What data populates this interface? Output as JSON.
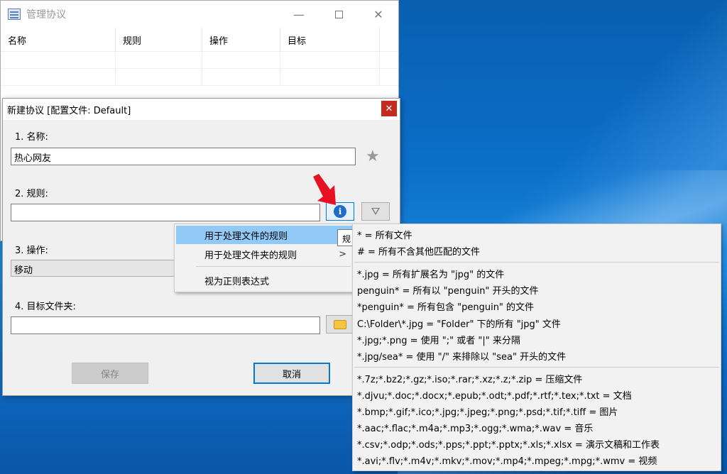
{
  "main": {
    "title": "管理协议",
    "columns": [
      "名称",
      "规则",
      "操作",
      "目标"
    ]
  },
  "dialog": {
    "title": "新建协议 [配置文件: Default]",
    "close": "✕",
    "name_label": "1.  名称:",
    "name_value": "热心网友",
    "rule_label": "2.  规则:",
    "rule_value": "",
    "action_label": "3.  操作:",
    "action_value": "移动",
    "target_label": "4.  目标文件夹:",
    "target_value": "",
    "save_label": "保存",
    "cancel_label": "取消"
  },
  "context_menu": {
    "items": [
      {
        "label": "用于处理文件的规则"
      },
      {
        "label": "用于处理文件夹的规则",
        "chevron": ">"
      },
      {
        "label": "视为正则表达式"
      }
    ]
  },
  "tooltip": {
    "text": "规"
  },
  "help": {
    "group1": [
      "* = 所有文件",
      "# = 所有不含其他匹配的文件"
    ],
    "group2": [
      "*.jpg = 所有扩展名为 \"jpg\" 的文件",
      "penguin* = 所有以 \"penguin\" 开头的文件",
      "*penguin* = 所有包含 \"penguin\" 的文件",
      "C:\\Folder\\*.jpg = \"Folder\" 下的所有 \"jpg\" 文件",
      "*.jpg;*.png = 使用 \";\" 或者 \"|\" 来分隔",
      "*.jpg/sea* = 使用 \"/\" 来排除以 \"sea\" 开头的文件"
    ],
    "group3": [
      "*.7z;*.bz2;*.gz;*.iso;*.rar;*.xz;*.z;*.zip = 压缩文件",
      "*.djvu;*.doc;*.docx;*.epub;*.odt;*.pdf;*.rtf;*.tex;*.txt = 文档",
      "*.bmp;*.gif;*.ico;*.jpg;*.jpeg;*.png;*.psd;*.tif;*.tiff = 图片",
      "*.aac;*.flac;*.m4a;*.mp3;*.ogg;*.wma;*.wav = 音乐",
      "*.csv;*.odp;*.ods;*.pps;*.ppt;*.pptx;*.xls;*.xlsx = 演示文稿和工作表",
      "*.avi;*.flv;*.m4v;*.mkv;*.mov;*.mp4;*.mpeg;*.mpg;*.wmv = 视频"
    ]
  },
  "colors": {
    "accent": "#0078d7",
    "close_red": "#c42b1c",
    "menu_highlight": "#91c9f7",
    "arrow_red": "#e81123"
  }
}
